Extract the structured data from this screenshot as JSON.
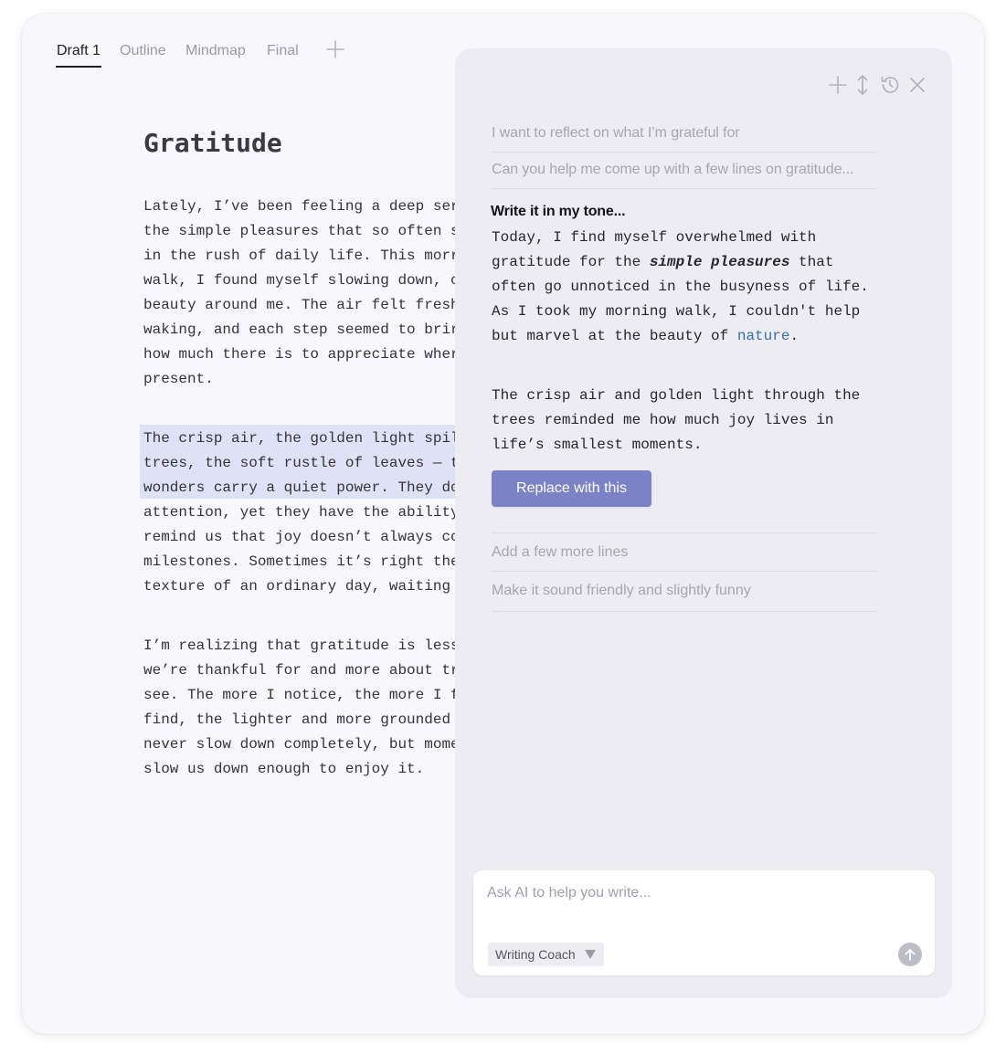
{
  "tabs": [
    {
      "label": "Draft 1",
      "active": true
    },
    {
      "label": "Outline",
      "active": false
    },
    {
      "label": "Mindmap",
      "active": false
    },
    {
      "label": "Final",
      "active": false
    }
  ],
  "icons": {
    "add_tab": "plus-icon",
    "panel_new": "plus-icon",
    "panel_resize": "vertical-resize-icon",
    "panel_history": "history-icon",
    "panel_close": "close-icon",
    "send": "arrow-up-icon"
  },
  "document": {
    "title": "Gratitude",
    "paragraphs": [
      "Lately, I’ve been feeling a deep ser\nthe simple pleasures that so often s\nin the rush of daily life. This morr\nwalk, I found myself slowing down, c\nbeauty around me. The air felt fresh\nwaking, and each step seemed to brir\nhow much there is to appreciate wher\npresent.",
      "The crisp air, the golden light spil\ntrees, the soft rustle of leaves — t\nwonders carry a quiet power. They do\nattention, yet they have the ability\nremind us that joy doesn’t always cc\nmilestones. Sometimes it’s right the\ntexture of an ordinary day, waiting",
      "I’m realizing that gratitude is less\nwe’re thankful for and more about tr\nsee. The more I notice, the more I f\nfind, the lighter and more grounded\nnever slow down completely, but mome\nslow us down enough to enjoy it."
    ]
  },
  "panel": {
    "history": [
      "I want to reflect on what I’m grateful for",
      "Can you help me come up with a few lines on gratitude..."
    ],
    "current_prompt": "Write it in my tone...",
    "response": {
      "p1_a": "Today, I find myself overwhelmed with\ngratitude for the ",
      "p1_em": "simple pleasures",
      "p1_b": " that\noften go unnoticed in the busyness of life.\nAs I took my morning walk, I couldn't help\nbut marvel at the beauty of ",
      "p1_link": "nature",
      "p1_c": ".",
      "p2": "The crisp air and golden light through the\ntrees reminded me how much joy lives in\nlife’s smallest moments."
    },
    "replace_button": "Replace with this",
    "suggestions": [
      "Add a few more lines",
      "Make it sound friendly and slightly funny"
    ],
    "input": {
      "placeholder": "Ask AI to help you write...",
      "value": ""
    },
    "mode_selector": "Writing Coach"
  },
  "colors": {
    "accent_button": "#7b82c6",
    "highlight": "#dfe1f5",
    "link": "#3a6ea8",
    "panel_bg": "#ececf2",
    "page_bg": "#f7f7fc"
  }
}
